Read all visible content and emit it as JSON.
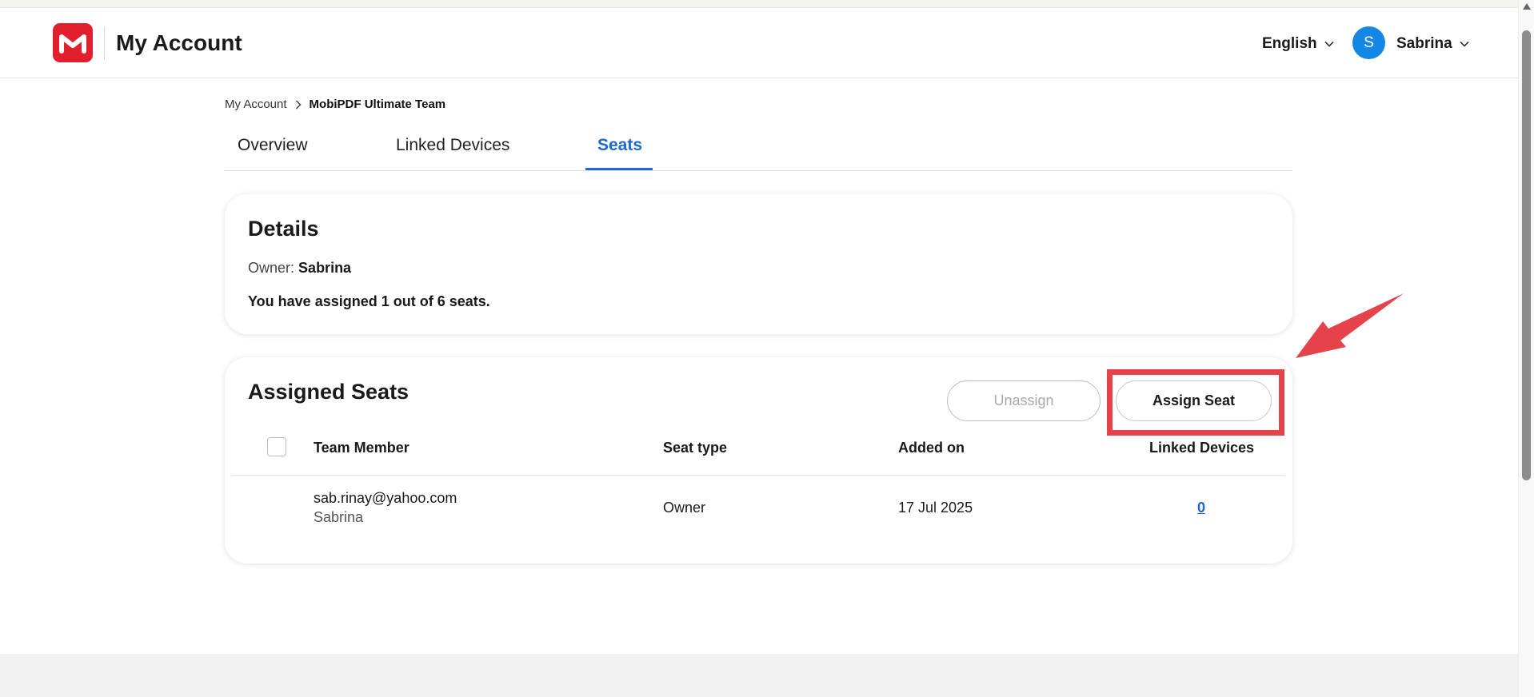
{
  "header": {
    "title": "My Account",
    "language": "English",
    "user_initial": "S",
    "user_name": "Sabrina",
    "logo_icon": "mobisystems-m-logo",
    "brand_color": "#e41f2d"
  },
  "breadcrumb": {
    "root": "My Account",
    "current": "MobiPDF Ultimate Team"
  },
  "tabs": [
    {
      "label": "Overview",
      "active": false
    },
    {
      "label": "Linked Devices",
      "active": false
    },
    {
      "label": "Seats",
      "active": true
    }
  ],
  "details": {
    "title": "Details",
    "owner_label": "Owner:",
    "owner_name": "Sabrina",
    "seats_summary": "You have assigned 1 out of 6 seats."
  },
  "assigned_seats": {
    "title": "Assigned Seats",
    "unassign_label": "Unassign",
    "assign_label": "Assign Seat",
    "columns": [
      "Team Member",
      "Seat type",
      "Added on",
      "Linked Devices"
    ],
    "rows": [
      {
        "email": "sab.rinay@yahoo.com",
        "name": "Sabrina",
        "seat_type": "Owner",
        "added_on": "17 Jul 2025",
        "linked_devices": "0"
      }
    ]
  },
  "colors": {
    "accent_blue": "#1d68d1",
    "avatar_blue": "#1387e6",
    "annotation_red": "#e5424a"
  }
}
